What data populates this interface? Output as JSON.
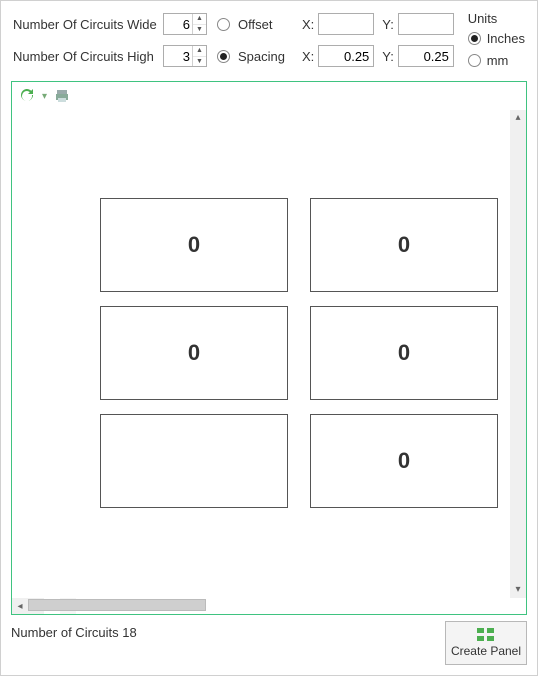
{
  "controls": {
    "wide_label": "Number Of Circuits Wide",
    "wide_value": "6",
    "high_label": "Number Of Circuits High",
    "high_value": "3",
    "offset_label": "Offset",
    "spacing_label": "Spacing",
    "x_label": "X:",
    "y_label": "Y:",
    "offset_x": "",
    "offset_y": "",
    "spacing_x": "0.25",
    "spacing_y": "0.25",
    "units_header": "Units",
    "units_inches": "Inches",
    "units_mm": "mm",
    "units_selected": "inches",
    "mode_selected": "spacing"
  },
  "preview": {
    "cells": [
      "0",
      "0",
      "",
      "0",
      "0",
      "",
      "",
      "0",
      ""
    ]
  },
  "footer": {
    "status": "Number of Circuits 18",
    "create_label": "Create Panel"
  }
}
